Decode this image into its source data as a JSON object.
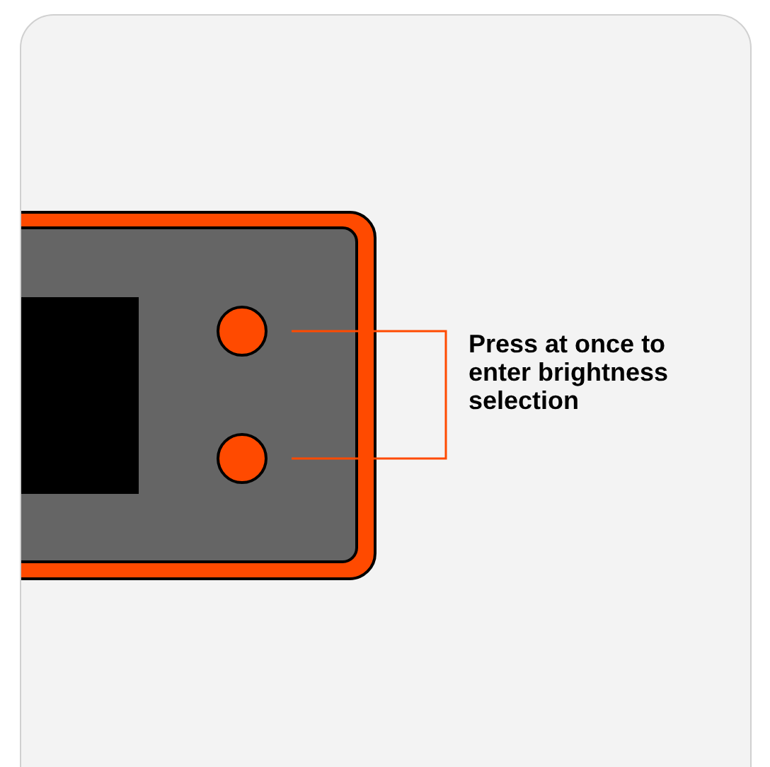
{
  "callout": {
    "label": "Press at once to enter brightness selection"
  }
}
